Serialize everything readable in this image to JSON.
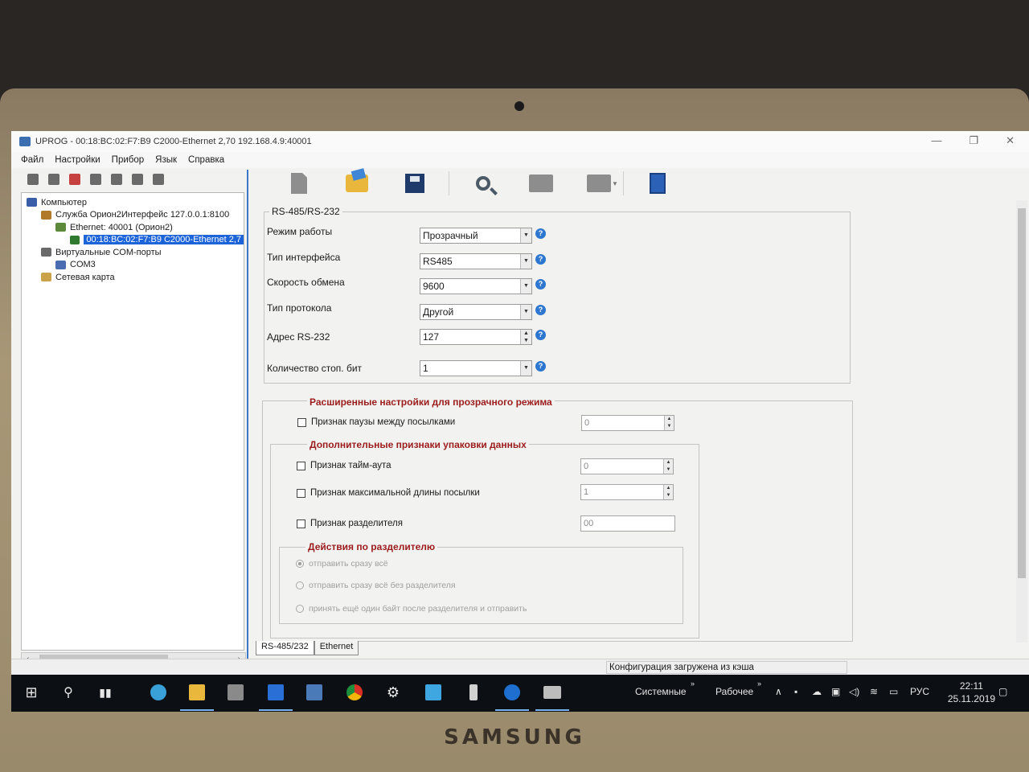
{
  "window": {
    "title": "UPROG - 00:18:BC:02:F7:B9  C2000-Ethernet 2,70 192.168.4.9:40001"
  },
  "menu": [
    "Файл",
    "Настройки",
    "Прибор",
    "Язык",
    "Справка"
  ],
  "tree": {
    "items": [
      {
        "label": "Компьютер",
        "indent": 0,
        "icon": "computer-icon",
        "color": "#3a5da8"
      },
      {
        "label": "Служба Орион2Интерфейс 127.0.0.1:8100",
        "indent": 1,
        "icon": "service-icon",
        "color": "#b07a2a"
      },
      {
        "label": "Ethernet: 40001  (Орион2)",
        "indent": 2,
        "icon": "ethernet-icon",
        "color": "#5c8a3a"
      },
      {
        "label": "00:18:BC:02:F7:B9  C2000-Ethernet 2,7",
        "indent": 3,
        "icon": "device-icon",
        "color": "#2f7a2f",
        "selected": true
      },
      {
        "label": "Виртуальные COM-порты",
        "indent": 1,
        "icon": "com-ports-icon",
        "color": "#6a6a6a"
      },
      {
        "label": "COM3",
        "indent": 2,
        "icon": "com-port-icon",
        "color": "#4a6cb0"
      },
      {
        "label": "Сетевая карта",
        "indent": 1,
        "icon": "network-card-icon",
        "color": "#c9a24a"
      }
    ]
  },
  "rs_group": {
    "title": "RS-485/RS-232",
    "fields": [
      {
        "label": "Режим работы",
        "value": "Прозрачный"
      },
      {
        "label": "Тип интерфейса",
        "value": "RS485"
      },
      {
        "label": "Скорость обмена",
        "value": "9600"
      },
      {
        "label": "Тип протокола",
        "value": "Другой"
      },
      {
        "label": "Адрес RS-232",
        "value": "127"
      },
      {
        "label": "Количество стоп. бит",
        "value": "1"
      }
    ]
  },
  "advanced": {
    "title": "Расширенные настройки для прозрачного режима",
    "pause_label": "Признак паузы между посылками",
    "pause_value": "0",
    "packing_title": "Дополнительные признаки упаковки данных",
    "timeout_label": "Признак тайм-аута",
    "timeout_value": "0",
    "maxlen_label": "Признак максимальной длины посылки",
    "maxlen_value": "1",
    "separator_label": "Признак разделителя",
    "separator_value": "00",
    "actions_title": "Действия по разделителю",
    "actions": [
      "отправить сразу всё",
      "отправить сразу всё без разделителя",
      "принять ещё один байт после разделителя и отправить"
    ]
  },
  "tabs": [
    "RS-485/232",
    "Ethernet"
  ],
  "status": {
    "message": "Конфигурация загружена из кэша"
  },
  "taskbar": {
    "toolbar1": "Системные",
    "toolbar2": "Рабочее",
    "lang": "РУС",
    "time": "22:11",
    "date": "25.11.2019"
  },
  "brand": "SAMSUNG",
  "colors": {
    "accent": "#1c64d8",
    "red_title": "#9b1c1c"
  }
}
